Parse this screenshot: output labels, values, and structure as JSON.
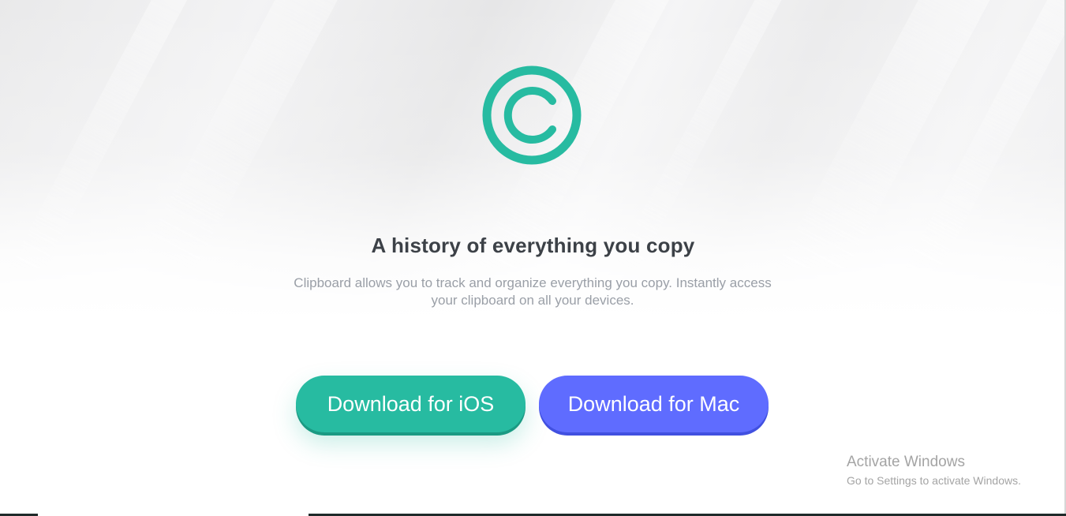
{
  "hero": {
    "logo_icon": "copyright-c-icon",
    "accent_color": "#27bba1",
    "headline": "A history of everything you copy",
    "subtext": "Clipboard allows you to track and organize everything you copy. Instantly access your clipboard on all your devices."
  },
  "buttons": {
    "ios_label": "Download for iOS",
    "ios_color": "#27bba1",
    "mac_label": "Download for Mac",
    "mac_color": "#5f6cff"
  },
  "watermark": {
    "title": "Activate Windows",
    "subtitle": "Go to Settings to activate Windows."
  }
}
